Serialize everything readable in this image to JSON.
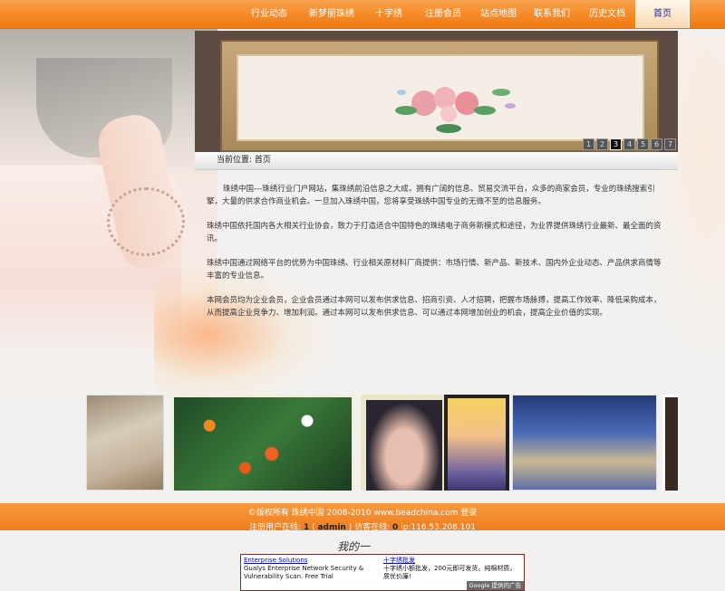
{
  "nav": [
    {
      "label": "行业动态"
    },
    {
      "label": "新梦丽珠绣"
    },
    {
      "label": "十字绣"
    },
    {
      "label": "注册会员"
    },
    {
      "label": "站点地图"
    },
    {
      "label": "联系我们"
    },
    {
      "label": "历史文档"
    },
    {
      "label": "首页"
    }
  ],
  "banner": {
    "pages": [
      "1",
      "2",
      "3",
      "4",
      "5",
      "6",
      "7"
    ],
    "active_page": "3"
  },
  "breadcrumb": "当前位置: 首页",
  "content": {
    "p1": "珠绣中国---珠绣行业门户网站，集珠绣前沿信息之大成，拥有广阔的信息、贸易交流平台，众多的商家会员，专业的珠绣搜索引擎，大量的供求合作商业机会。一旦加入珠绣中国，您将享受珠绣中国专业的无微不至的信息服务。",
    "p2": "珠绣中国依托国内各大相关行业协会，致力于打造适合中国特色的珠绣电子商务新模式和途径，为业界提供珠绣行业最新、最全面的资讯。",
    "p3": "珠绣中国通过网络平台的优势为中国珠绣、行业相关原材料厂商提供：市场行情、新产品、新技术、国内外企业动态、产品供求商情等丰富的专业信息。",
    "p4": "本网会员均为企业会员，企业会员通过本网可以发布供求信息、招商引资、人才招聘，把握市场脉搏，提高工作效率、降低采购成本，从而提高企业竞争力、增加利润。通过本网可以发布供求信息、可以通过本网增加创业的机会，提高企业价值的实现。"
  },
  "footer": {
    "copyright": "©版权所有 珠绣中国 2008-2010 www.beadchina.com",
    "login": "登录",
    "online_prefix": "注册用户在线: ",
    "online_users": "1",
    "online_open": " ( ",
    "admin": "admin",
    "online_close": " )",
    "guests_prefix": " 访客在线: ",
    "guests": "0",
    "ip": " ip:116.53.208.101"
  },
  "logo_text": "我的一",
  "ad": {
    "left_title": "Enterprise Solutions",
    "left_body": "Gualys Enterprise Network Security & Vulnerability Scan. Free Trial",
    "right_title": "十字绣批发",
    "right_body": "十字绣小额批发，200元即可发货。纯棉材质，质优价廉!",
    "badge": "Google 提供的广告"
  }
}
